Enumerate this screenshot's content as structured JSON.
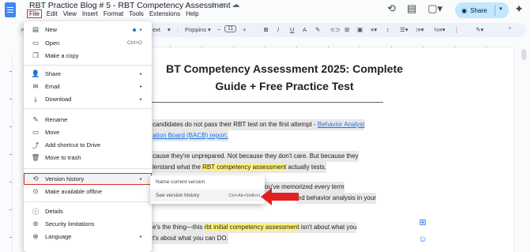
{
  "doc": {
    "title": "RBT Practice Blog # 5 - RBT Competency Assessment"
  },
  "menubar": [
    "File",
    "Edit",
    "View",
    "Insert",
    "Format",
    "Tools",
    "Extensions",
    "Help"
  ],
  "share_label": "Share",
  "toolbar": {
    "text_style": "ext",
    "font": "Poppins",
    "font_size": "11",
    "bold": "B",
    "italic": "I",
    "underline": "U",
    "text_color": "A"
  },
  "document": {
    "heading_line1": "BT Competency Assessment 2025: Complete",
    "heading_line2": "Guide + Free Practice Test",
    "p1_a": "candidates do not pass their RBT test on the first attempt - ",
    "p1_link_a": "Behavior Analyst",
    "p1_link_b": "ation Board (BACB) report.",
    "p2_a": "cause they're unprepared. Not because they don't care. But because they",
    "p2_b": "lerstand what the ",
    "p2_hl": "RBT competency assessment",
    "p2_c": " actually tests.",
    "p3_a": "r training. You've memorized every term",
    "p3_b": "ied behavior analysis in your",
    "p4_a": "e's the thing—this ",
    "p4_hl": "rbt initial competency assessment",
    "p4_b": " isn't about what you",
    "p4_c": "t's about what you can DO."
  },
  "file_menu": {
    "new": "New",
    "open": "Open",
    "open_shortcut": "Ctrl+O",
    "make_copy": "Make a copy",
    "share": "Share",
    "email": "Email",
    "download": "Download",
    "rename": "Rename",
    "move": "Move",
    "add_shortcut": "Add shortcut to Drive",
    "trash": "Move to trash",
    "version_history": "Version history",
    "offline": "Make available offline",
    "details": "Details",
    "security": "Security limitations",
    "language": "Language"
  },
  "version_submenu": {
    "name_current": "Name current version",
    "see_history": "See version history",
    "see_history_shortcut": "Ctrl+Alt+Shift+H"
  }
}
